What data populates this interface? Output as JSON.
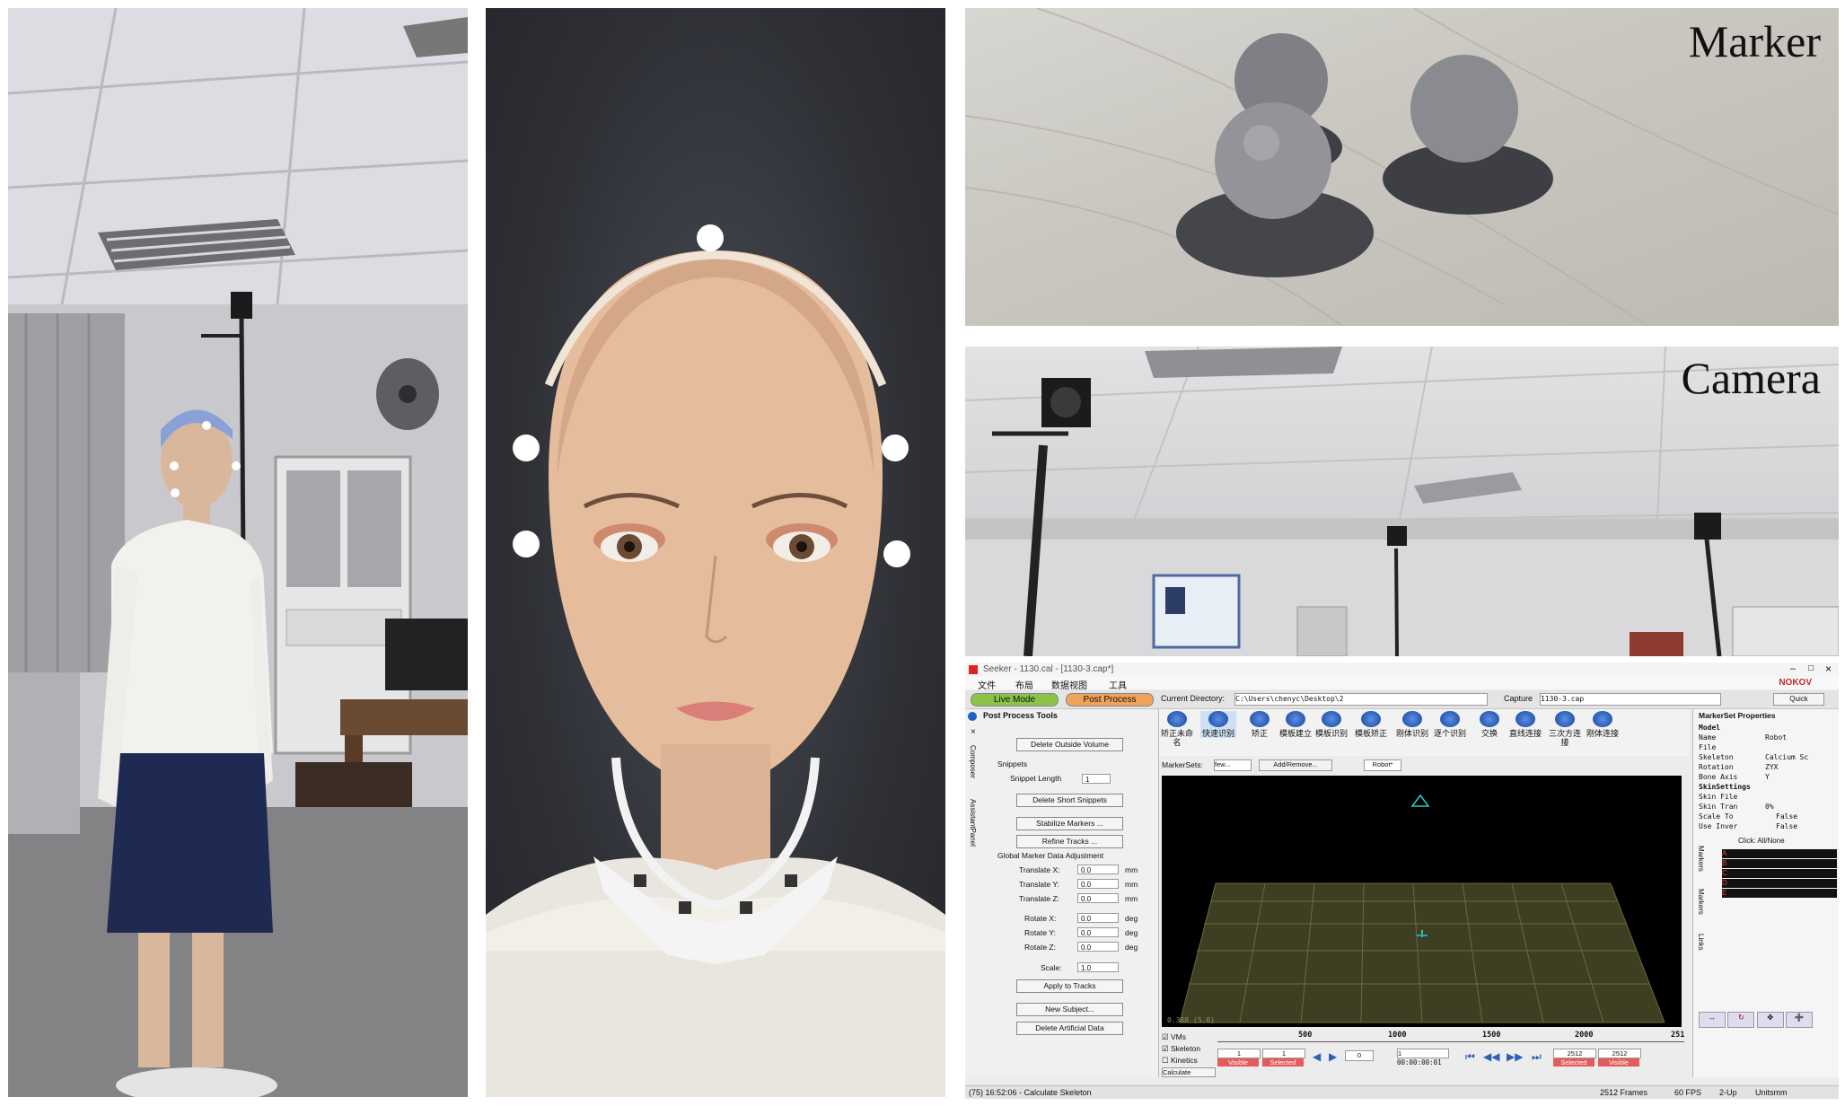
{
  "labels": {
    "marker": "Marker",
    "camera": "Camera"
  },
  "seeker": {
    "title": "Seeker - 1130.cal - [1130-3.cap*]",
    "menu": [
      "文件",
      "布局",
      "数据视图",
      "工具"
    ],
    "brand": "NOKOV",
    "live_mode": "Live Mode",
    "post_process": "Post Process",
    "current_directory_label": "Current Directory:",
    "current_directory_value": "C:\\Users\\chenyc\\Desktop\\2",
    "capture_label": "Capture",
    "capture_value": "1130-3.cap",
    "quick_label": "Quick",
    "panel_title": "Post Process Tools",
    "side_tabs": [
      "Composer",
      "AssistantPanel"
    ],
    "delete_outside_volume": "Delete Outside Volume",
    "snippets_label": "Snippets",
    "snippet_length_label": "Snippet Length",
    "snippet_length_value": "1",
    "delete_short_snippets": "Delete Short Snippets",
    "stabilize_markers": "Stabilize Markers ...",
    "refine_tracks": "Refine Tracks ...",
    "global_adjust_label": "Global Marker Data Adjustment",
    "adjust_fields": [
      {
        "label": "Translate X:",
        "value": "0.0",
        "unit": "mm"
      },
      {
        "label": "Translate Y:",
        "value": "0.0",
        "unit": "mm"
      },
      {
        "label": "Translate Z:",
        "value": "0.0",
        "unit": "mm"
      },
      {
        "label": "Rotate X:",
        "value": "0.0",
        "unit": "deg"
      },
      {
        "label": "Rotate Y:",
        "value": "0.0",
        "unit": "deg"
      },
      {
        "label": "Rotate Z:",
        "value": "0.0",
        "unit": "deg"
      },
      {
        "label": "Scale:",
        "value": "1.0",
        "unit": ""
      }
    ],
    "apply_to_tracks": "Apply to Tracks",
    "new_subject": "New Subject...",
    "delete_artificial_data": "Delete Artificial Data",
    "tools": [
      "矫正未命名",
      "快速识别",
      "矫正",
      "模板建立",
      "模板识别",
      "模板矫正",
      "刚体识别",
      "逐个识别",
      "交换",
      "直线连接",
      "三次方连接",
      "刚体连接"
    ],
    "markersets_label": "MarkerSets:",
    "markersets_value": "few...",
    "add_remove": "Add/Remove...",
    "robot_tab": "Robot*",
    "viewport_readout": "0.388 (5.0)",
    "props_title": "MarkerSet Properties",
    "props": [
      {
        "k": "Model",
        "v": ""
      },
      {
        "k": "Name",
        "v": "Robot"
      },
      {
        "k": "File",
        "v": ""
      },
      {
        "k": "Skeleton",
        "v": "Calcium Sc"
      },
      {
        "k": "Rotation",
        "v": "ZYX"
      },
      {
        "k": "Bone Axis",
        "v": "Y"
      },
      {
        "k": "SkinSettings",
        "v": ""
      },
      {
        "k": "Skin File",
        "v": ""
      },
      {
        "k": "Skin Tran",
        "v": "0%"
      },
      {
        "k": "Scale To",
        "v": "False"
      },
      {
        "k": "Use Inver",
        "v": "False"
      }
    ],
    "click_all_none": "Click: All/None",
    "markers": [
      "A",
      "B",
      "C",
      "D",
      "E"
    ],
    "right_tabs": [
      "Markers",
      "Markers",
      "Links"
    ],
    "checks": [
      "VMs",
      "Skeleton",
      "Kinetics"
    ],
    "calculate": "Calculate",
    "ticks": [
      "500",
      "1000",
      "1500",
      "2000",
      "251"
    ],
    "frame_start": "1",
    "frame_sel": "1",
    "visible_a": "Visible",
    "selected_a": "Selected",
    "speed_value": "0",
    "frame_cur": "1",
    "timecode": "00:00:00:01",
    "frame_end_sel": "2512",
    "frame_end": "2512",
    "selected_b": "Selected",
    "visible_b": "Visible",
    "status_left": "(75) 16:52:06 - Calculate Skeleton",
    "status_frames": "2512 Frames",
    "status_fps": "60 FPS",
    "status_up": "2-Up",
    "status_units": "Unitsmm"
  }
}
